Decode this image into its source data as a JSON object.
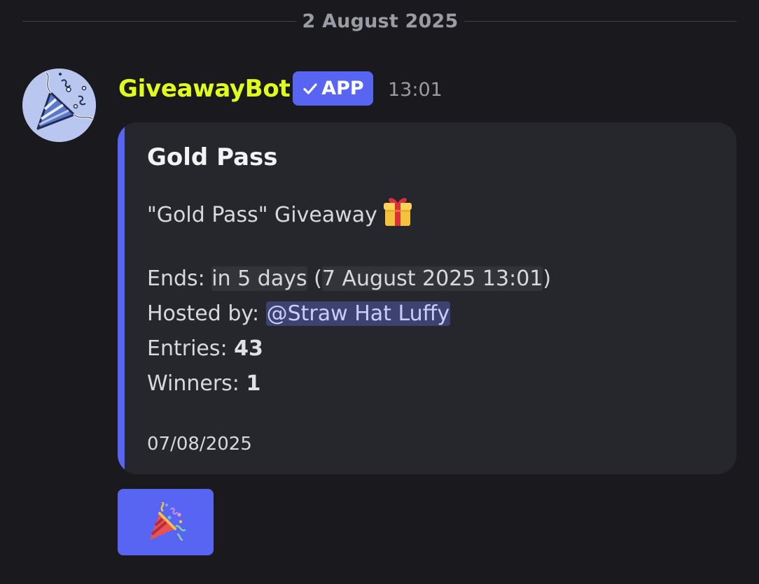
{
  "divider": {
    "date": "2 August 2025"
  },
  "message": {
    "author": "GiveawayBot",
    "author_color": "#e0ff1a",
    "badge_label": "APP",
    "badge_icon": "checkmark-icon",
    "timestamp": "13:01",
    "avatar_icon": "party-popper-icon"
  },
  "embed": {
    "accent_color": "#5865f2",
    "title": "Gold Pass",
    "description": "\"Gold Pass\" Giveaway",
    "description_icon": "gift-icon",
    "ends_label": "Ends:",
    "ends_relative": "in 5 days",
    "ends_absolute": "7 August 2025 13:01",
    "hosted_label": "Hosted by:",
    "host_mention": "@Straw Hat Luffy",
    "entries_label": "Entries:",
    "entries_count": "43",
    "winners_label": "Winners:",
    "winners_count": "1",
    "footer_date": "07/08/2025"
  },
  "enter_button": {
    "icon": "party-popper-icon",
    "color": "#5865f2"
  }
}
